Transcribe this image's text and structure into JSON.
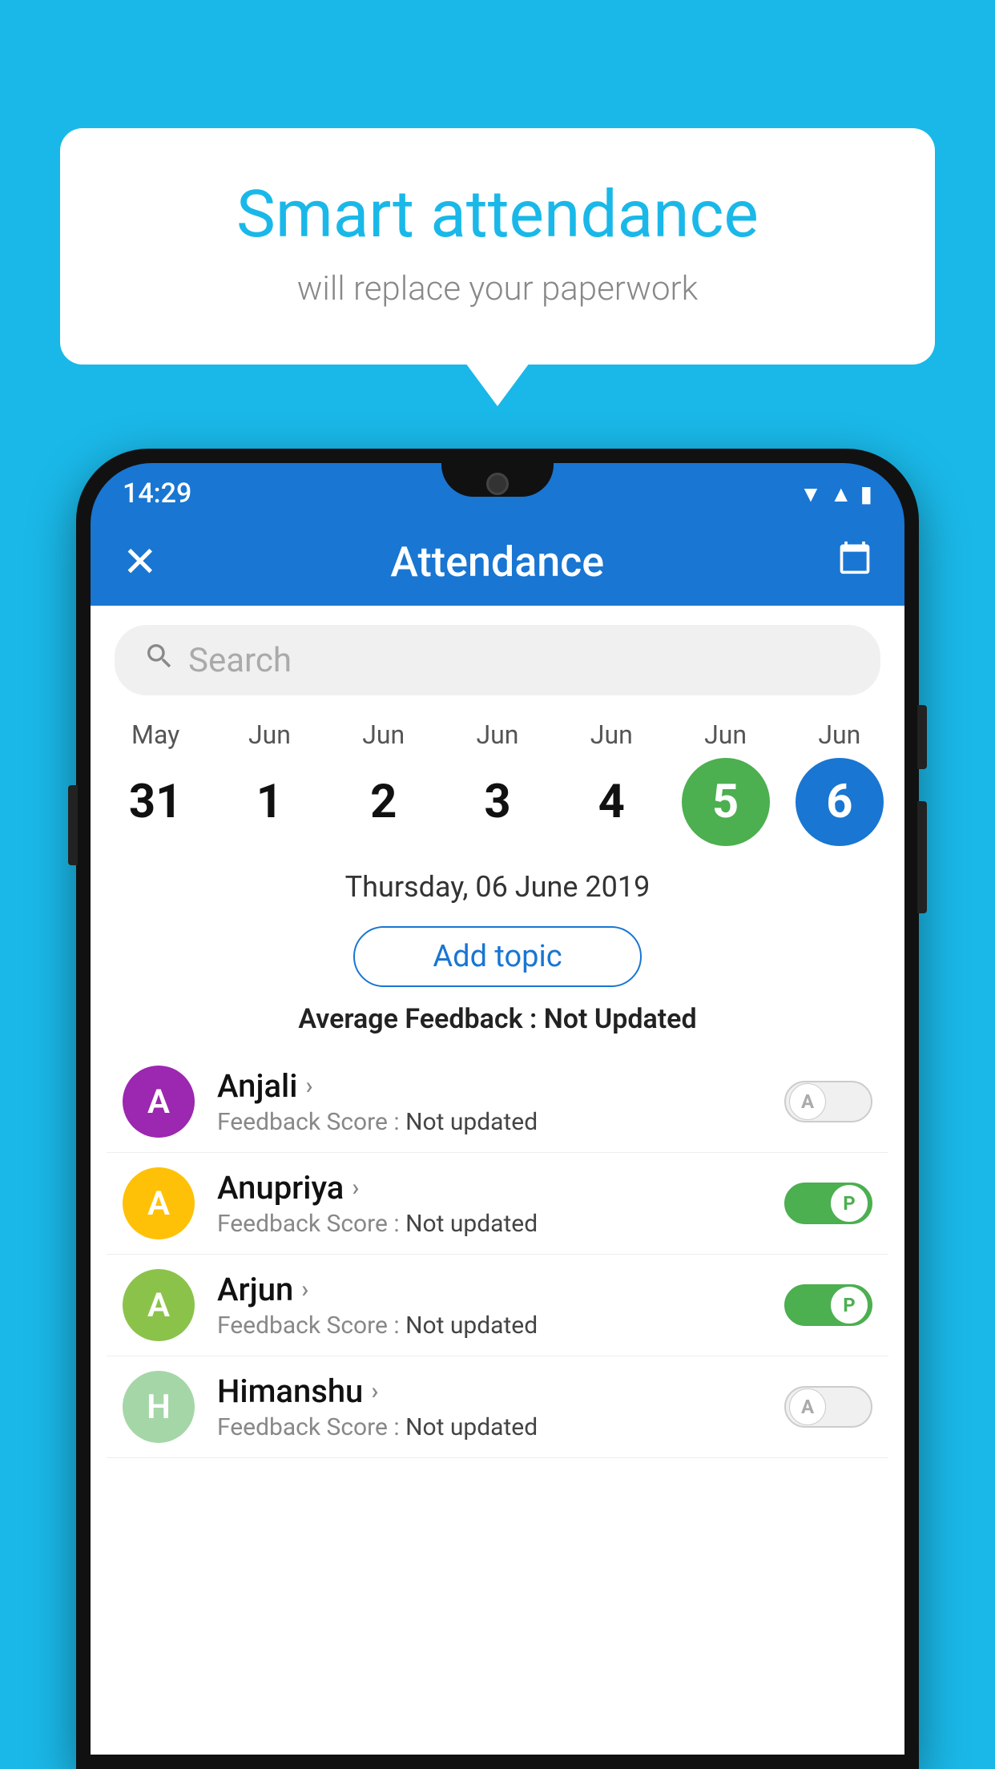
{
  "background_color": "#1ab8e8",
  "bubble": {
    "title": "Smart attendance",
    "subtitle": "will replace your paperwork"
  },
  "status_bar": {
    "time": "14:29",
    "icons": [
      "wifi",
      "signal",
      "battery"
    ]
  },
  "app_bar": {
    "title": "Attendance",
    "close_label": "✕",
    "calendar_label": "📅"
  },
  "search": {
    "placeholder": "Search"
  },
  "calendar": {
    "dates": [
      {
        "month": "May",
        "day": "31",
        "style": "normal"
      },
      {
        "month": "Jun",
        "day": "1",
        "style": "normal"
      },
      {
        "month": "Jun",
        "day": "2",
        "style": "normal"
      },
      {
        "month": "Jun",
        "day": "3",
        "style": "normal"
      },
      {
        "month": "Jun",
        "day": "4",
        "style": "normal"
      },
      {
        "month": "Jun",
        "day": "5",
        "style": "today"
      },
      {
        "month": "Jun",
        "day": "6",
        "style": "selected"
      }
    ]
  },
  "selected_date": "Thursday, 06 June 2019",
  "add_topic_label": "Add topic",
  "average_feedback": {
    "label": "Average Feedback : ",
    "value": "Not Updated"
  },
  "students": [
    {
      "name": "Anjali",
      "avatar_letter": "A",
      "avatar_color": "#9c27b0",
      "feedback_label": "Feedback Score : ",
      "feedback_value": "Not updated",
      "toggle": "off",
      "toggle_letter": "A"
    },
    {
      "name": "Anupriya",
      "avatar_letter": "A",
      "avatar_color": "#ffc107",
      "feedback_label": "Feedback Score : ",
      "feedback_value": "Not updated",
      "toggle": "on",
      "toggle_letter": "P"
    },
    {
      "name": "Arjun",
      "avatar_letter": "A",
      "avatar_color": "#8bc34a",
      "feedback_label": "Feedback Score : ",
      "feedback_value": "Not updated",
      "toggle": "on",
      "toggle_letter": "P"
    },
    {
      "name": "Himanshu",
      "avatar_letter": "H",
      "avatar_color": "#a5d6a7",
      "feedback_label": "Feedback Score : ",
      "feedback_value": "Not updated",
      "toggle": "off",
      "toggle_letter": "A"
    }
  ]
}
